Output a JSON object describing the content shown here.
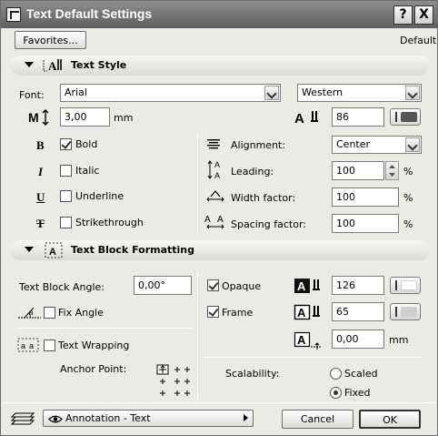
{
  "window": {
    "title": "Text Default Settings",
    "help_btn": "?",
    "close_btn": "X"
  },
  "top": {
    "favorites": "Favorites...",
    "default_label": "Default"
  },
  "text_style": {
    "section_title": "Text Style",
    "font_label": "Font:",
    "font_value": "Arial",
    "script_value": "Western",
    "size_value": "3,00",
    "size_unit": "mm",
    "pen_value": "86",
    "pen_color": "#555555",
    "bold": "Bold",
    "italic": "Italic",
    "underline": "Underline",
    "strikethrough": "Strikethrough",
    "bold_checked": true,
    "alignment_label": "Alignment:",
    "alignment_value": "Center",
    "leading_label": "Leading:",
    "leading_value": "100",
    "width_label": "Width factor:",
    "width_value": "100",
    "spacing_label": "Spacing factor:",
    "spacing_value": "100",
    "percent": "%"
  },
  "text_block": {
    "section_title": "Text Block Formatting",
    "angle_label": "Text Block Angle:",
    "angle_value": "0,00°",
    "fix_angle": "Fix Angle",
    "text_wrapping": "Text Wrapping",
    "anchor_label": "Anchor Point:",
    "opaque": "Opaque",
    "frame": "Frame",
    "opaque_pen": "126",
    "frame_pen": "65",
    "offset_value": "0,00",
    "offset_unit": "mm",
    "scalability_label": "Scalability:",
    "scaled": "Scaled",
    "fixed": "Fixed",
    "opaque_color": "#ffffff",
    "frame_color": "#cfcfcf"
  },
  "footer": {
    "layer_value": "Annotation - Text",
    "cancel": "Cancel",
    "ok": "OK"
  }
}
